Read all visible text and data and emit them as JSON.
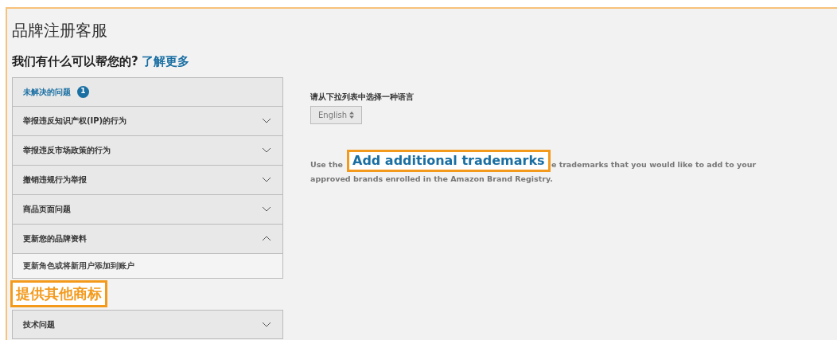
{
  "title": "品牌注册客服",
  "subtitle": {
    "text": "我们有什么可以帮您的?",
    "link": "了解更多"
  },
  "menu": [
    {
      "kind": "link",
      "label": "未解决的问题",
      "badge": "1"
    },
    {
      "kind": "section",
      "label": "举报违反知识产权(IP)的行为",
      "expanded": false
    },
    {
      "kind": "section",
      "label": "举报违反市场政策的行为",
      "expanded": false
    },
    {
      "kind": "section",
      "label": "撤销违规行为举报",
      "expanded": false
    },
    {
      "kind": "section",
      "label": "商品页面问题",
      "expanded": false
    },
    {
      "kind": "section",
      "label": "更新您的品牌资料",
      "expanded": true,
      "children": [
        {
          "label": "更新角色或将新用户添加到账户"
        }
      ]
    },
    {
      "kind": "callout",
      "label": "提供其他商标"
    },
    {
      "kind": "section",
      "label": "技术问题",
      "expanded": false
    }
  ],
  "language": {
    "label": "请从下拉列表中选择一种语言",
    "value": "English"
  },
  "description": {
    "before": "Use the",
    "after": "e trademarks that you would like to add to your",
    "line_2": "approved brands enrolled in the Amazon Brand Registry.",
    "callout": "Add additional trademarks"
  }
}
